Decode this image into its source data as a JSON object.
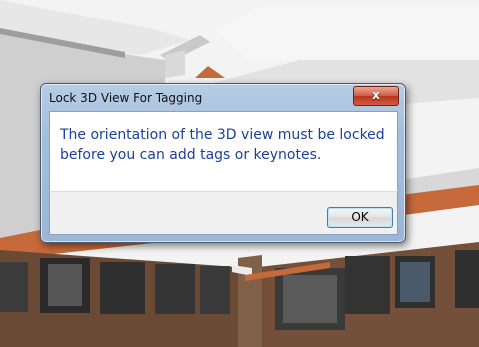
{
  "dialog": {
    "title": "Lock 3D View For Tagging",
    "close_label": "x",
    "message": "The orientation of the 3D view must be locked before you can add tags or keynotes.",
    "ok_label": "OK"
  }
}
